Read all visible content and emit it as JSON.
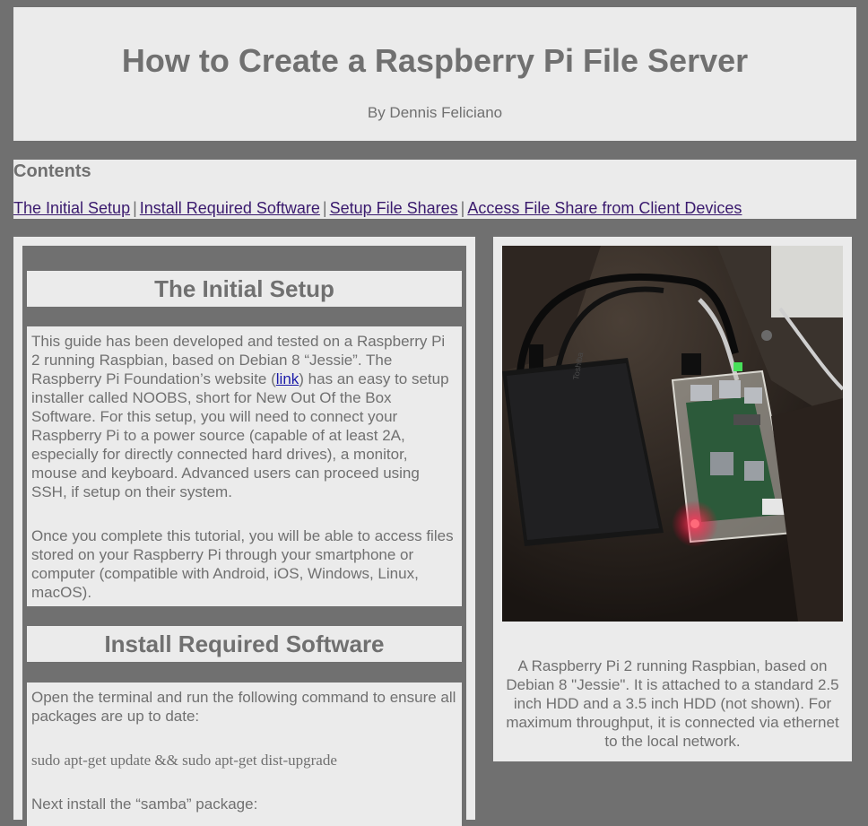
{
  "header": {
    "title": "How to Create a Raspberry Pi File Server",
    "byline": "By Dennis Feliciano"
  },
  "contents": {
    "title": "Contents",
    "links": [
      {
        "label": "The Initial Setup"
      },
      {
        "label": "Install Required Software"
      },
      {
        "label": "Setup File Shares"
      },
      {
        "label": "Access File Share from Client Devices"
      }
    ],
    "separator": "|"
  },
  "sections": {
    "initial_setup": {
      "heading": "The Initial Setup",
      "para1_before_link": "This guide has been developed and tested on a Raspberry Pi 2 running Raspbian, based on Debian 8 “Jessie”. The Raspberry Pi Foundation’s website (",
      "para1_link": "link",
      "para1_after_link": ") has an easy to setup installer called NOOBS, short for New Out Of the Box Software. For this setup, you will need to connect your Raspberry Pi to a power source (capable of at least 2A, especially for directly connected hard drives), a monitor, mouse and keyboard. Advanced users can proceed using SSH, if setup on their system.",
      "para2": "Once you complete this tutorial, you will be able to access files stored on your Raspberry Pi through your smartphone or computer (compatible with Android, iOS, Windows, Linux, macOS)."
    },
    "install_software": {
      "heading": "Install Required Software",
      "para1": "Open the terminal and run the following command to ensure all packages are up to date:",
      "command1": "sudo apt-get update && sudo apt-get dist-upgrade",
      "para2": "Next install the “samba” package:"
    }
  },
  "figure": {
    "image_desc": "raspberry-pi-photo",
    "caption": "A Raspberry Pi 2 running Raspbian, based on Debian 8 \"Jessie\". It is attached to a standard 2.5 inch HDD and a 3.5 inch HDD (not shown). For maximum throughput, it is connected via ethernet to the local network."
  },
  "colors": {
    "page_bg": "#707070",
    "panel_bg": "#ebebeb",
    "text": "#707070",
    "visited_link": "#3a1a6e",
    "link": "#1a1aa8"
  }
}
